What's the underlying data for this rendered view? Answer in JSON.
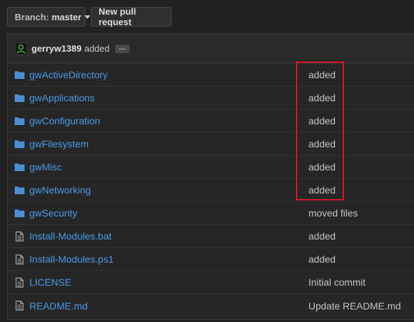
{
  "toolbar": {
    "branch_prefix": "Branch:",
    "branch_name": "master",
    "new_pr_label": "New pull request"
  },
  "commit": {
    "author": "gerryw1389",
    "message": "added",
    "ellipsis": "…"
  },
  "files": [
    {
      "type": "folder",
      "name": "gwActiveDirectory",
      "message": "added"
    },
    {
      "type": "folder",
      "name": "gwApplications",
      "message": "added"
    },
    {
      "type": "folder",
      "name": "gwConfiguration",
      "message": "added"
    },
    {
      "type": "folder",
      "name": "gwFilesystem",
      "message": "added"
    },
    {
      "type": "folder",
      "name": "gwMisc",
      "message": "added"
    },
    {
      "type": "folder",
      "name": "gwNetworking",
      "message": "added"
    },
    {
      "type": "folder",
      "name": "gwSecurity",
      "message": "moved files"
    },
    {
      "type": "file",
      "name": "Install-Modules.bat",
      "message": "added"
    },
    {
      "type": "file",
      "name": "Install-Modules.ps1",
      "message": "added"
    },
    {
      "type": "file",
      "name": "LICENSE",
      "message": "Initial commit"
    },
    {
      "type": "file",
      "name": "README.md",
      "message": "Update README.md"
    }
  ],
  "colors": {
    "link": "#4a9ae8",
    "highlight": "#d8182b",
    "background": "#222222"
  }
}
